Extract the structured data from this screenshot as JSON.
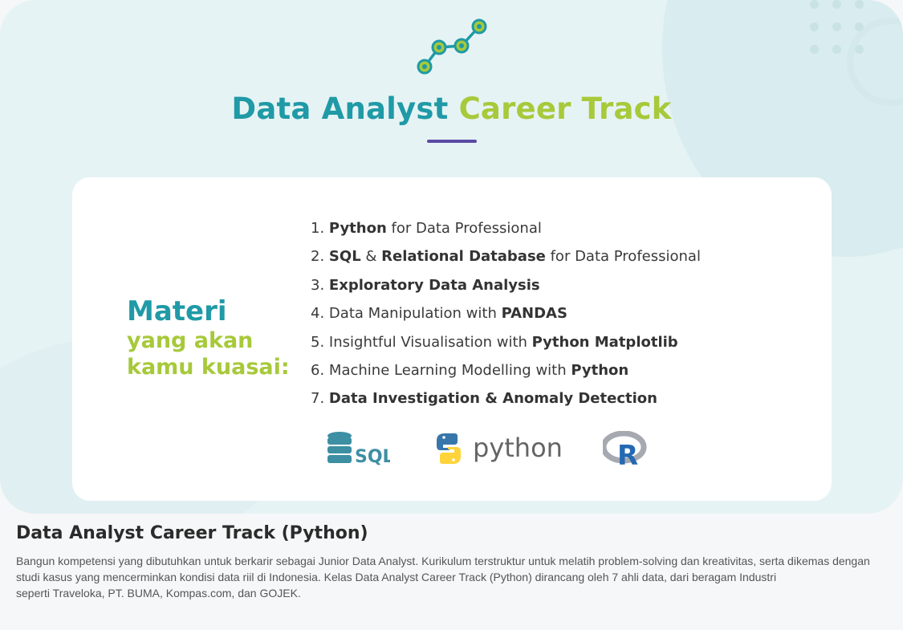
{
  "banner": {
    "title_part1": "Data Analyst",
    "title_part2": "Career Track",
    "materi_line1": "Materi",
    "materi_line2": "yang akan",
    "materi_line3": "kamu kuasai:",
    "topics": [
      {
        "number": "1.",
        "bold_a": "Python",
        "text_a": " for Data Professional",
        "bold_b": "",
        "text_b": "",
        "bold_c": "",
        "text_c": ""
      },
      {
        "number": "2.",
        "bold_a": "SQL",
        "text_a": " & ",
        "bold_b": "Relational Database",
        "text_b": " for Data Professional",
        "bold_c": "",
        "text_c": ""
      },
      {
        "number": "3.",
        "bold_a": "Exploratory Data Analysis",
        "text_a": "",
        "bold_b": "",
        "text_b": "",
        "bold_c": "",
        "text_c": ""
      },
      {
        "number": "4.",
        "bold_a": "",
        "text_a": "Data Manipulation with ",
        "bold_b": "PANDAS",
        "text_b": "",
        "bold_c": "",
        "text_c": ""
      },
      {
        "number": "5.",
        "bold_a": "",
        "text_a": "Insightful Visualisation with ",
        "bold_b": "Python Matplotlib",
        "text_b": "",
        "bold_c": "",
        "text_c": ""
      },
      {
        "number": "6.",
        "bold_a": "",
        "text_a": "Machine Learning Modelling with ",
        "bold_b": "Python",
        "text_b": "",
        "bold_c": "",
        "text_c": ""
      },
      {
        "number": "7.",
        "bold_a": "Data Investigation & Anomaly Detection",
        "text_a": "",
        "bold_b": "",
        "text_b": "",
        "bold_c": "",
        "text_c": ""
      }
    ],
    "logos": {
      "sql_label": "SQL",
      "python_label": "python",
      "r_label": "R"
    },
    "colors": {
      "teal": "#1f9aa6",
      "lime": "#a7c93a",
      "purple": "#5b4aa3"
    }
  },
  "description": {
    "title": "Data Analyst Career Track (Python)",
    "line1": "Bangun kompetensi yang dibutuhkan untuk berkarir sebagai Junior Data Analyst. Kurikulum terstruktur untuk melatih problem-solving dan kreativitas, serta dikemas dengan studi kasus yang mencerminkan kondisi data riil di Indonesia. Kelas Data Analyst Career Track (Python) dirancang oleh 7 ahli data, dari beragam Industri",
    "line2": "seperti Traveloka, PT. BUMA, Kompas.com, dan GOJEK."
  }
}
